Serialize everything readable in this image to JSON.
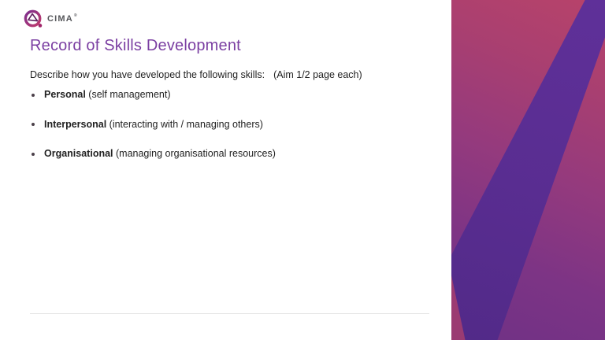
{
  "logo": {
    "brand": "CIMA",
    "trademark": "®",
    "icon": "cima-logo-icon"
  },
  "slide": {
    "title": "Record of Skills Development",
    "intro": "Describe how you have developed the following skills:",
    "aim_note": "(Aim 1/2 page each)",
    "bullets": [
      {
        "term": "Personal",
        "description": " (self management)"
      },
      {
        "term": "Interpersonal",
        "description": " (interacting with / managing others)"
      },
      {
        "term": "Organisational",
        "description": " (managing organisational resources)"
      }
    ]
  },
  "colors": {
    "title_purple": "#7B3FA2",
    "body_text": "#222222",
    "bullet_dot": "#4B4049",
    "divider": "#E4E4E4",
    "panel_rose": "#B8436A",
    "panel_magenta": "#953A7D",
    "panel_purple": "#6F3185",
    "panel_indigo_band": "#592D91",
    "logo_gray": "#55565A"
  }
}
